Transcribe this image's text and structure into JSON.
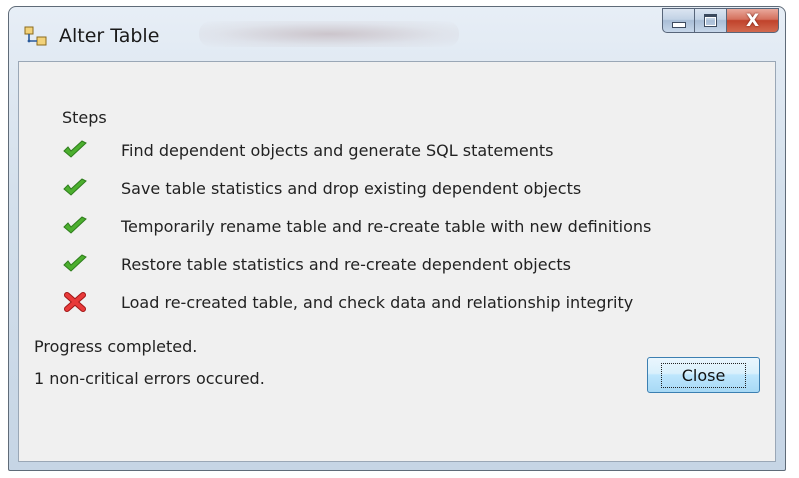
{
  "window": {
    "title": "Alter Table",
    "title_icon": "table-relations-icon",
    "caption_buttons": {
      "minimize_icon": "minimize-icon",
      "maximize_icon": "maximize-icon",
      "close_glyph": "X"
    }
  },
  "steps": {
    "label": "Steps",
    "items": [
      {
        "status": "success",
        "icon": "green-check-icon",
        "text": "Find dependent objects and generate SQL statements"
      },
      {
        "status": "success",
        "icon": "green-check-icon",
        "text": "Save table statistics and drop existing dependent objects"
      },
      {
        "status": "success",
        "icon": "green-check-icon",
        "text": "Temporarily rename table and re-create table with new definitions"
      },
      {
        "status": "success",
        "icon": "green-check-icon",
        "text": "Restore table statistics and re-create dependent objects"
      },
      {
        "status": "error",
        "icon": "red-x-icon",
        "text": "Load re-created table, and check data and relationship integrity"
      }
    ]
  },
  "status": {
    "line1": "Progress completed.",
    "line2": "1 non-critical errors occured."
  },
  "buttons": {
    "close_label": "Close"
  },
  "colors": {
    "success": "#4caf2f",
    "error": "#d92b2b",
    "close_caption": "#c0422b"
  }
}
